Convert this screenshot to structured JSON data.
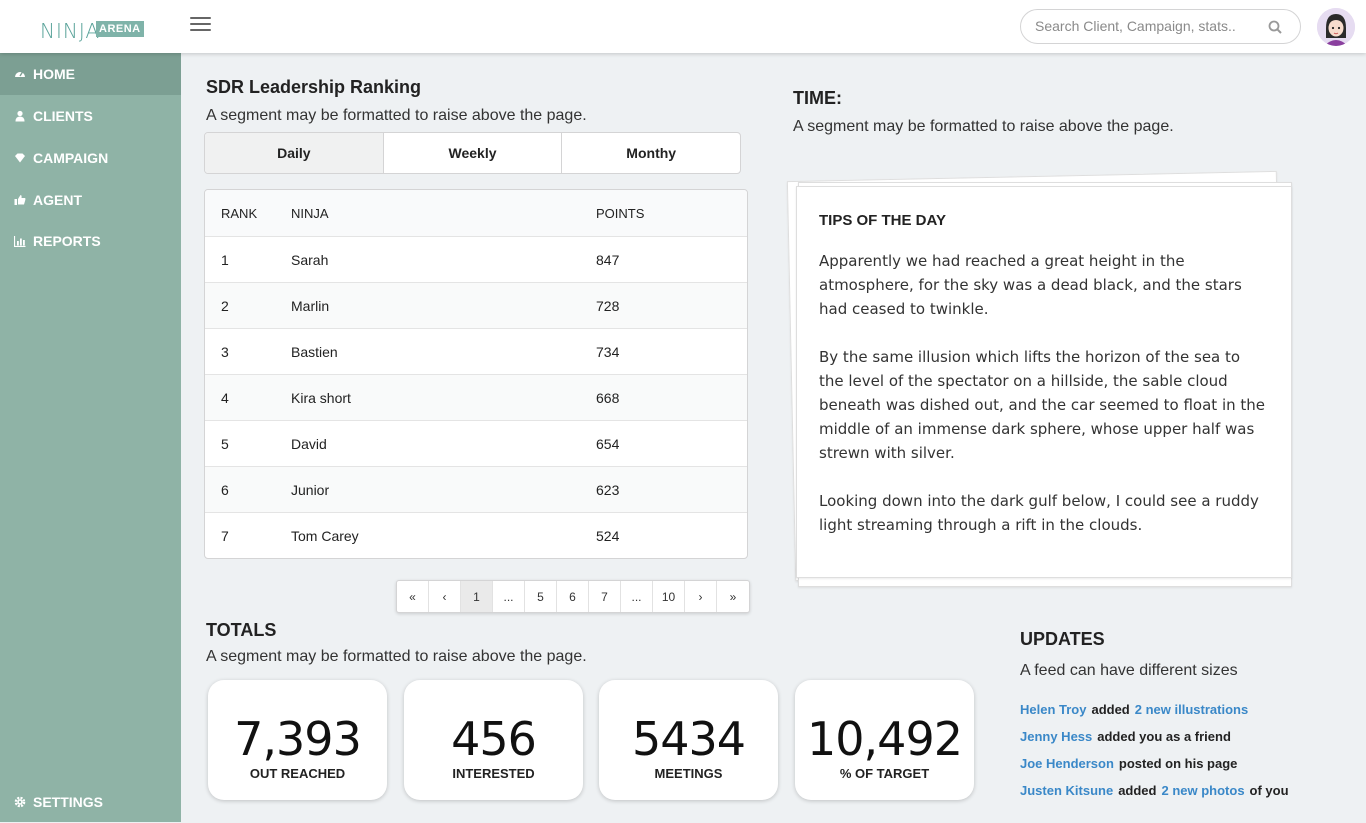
{
  "logo": {
    "ninja": "NINJA",
    "arena": "ARENA"
  },
  "search": {
    "placeholder": "Search Client, Campaign, stats.."
  },
  "sidebar": {
    "items": [
      {
        "label": "HOME",
        "icon": "dashboard-icon"
      },
      {
        "label": "CLIENTS",
        "icon": "user-icon"
      },
      {
        "label": "CAMPAIGN",
        "icon": "diamond-icon"
      },
      {
        "label": "AGENT",
        "icon": "thumbs-up-icon"
      },
      {
        "label": "REPORTS",
        "icon": "bar-chart-icon"
      }
    ],
    "settings": "SETTINGS"
  },
  "sdr": {
    "title": "SDR Leadership Ranking",
    "subtitle": "A segment may be formatted to raise above the page.",
    "tabs": [
      "Daily",
      "Weekly",
      "Monthy"
    ],
    "columns": [
      "RANK",
      "NINJA",
      "POINTS"
    ],
    "rows": [
      {
        "rank": "1",
        "name": "Sarah",
        "points": "847"
      },
      {
        "rank": "2",
        "name": "Marlin",
        "points": "728"
      },
      {
        "rank": "3",
        "name": "Bastien",
        "points": "734"
      },
      {
        "rank": "4",
        "name": "Kira short",
        "points": "668"
      },
      {
        "rank": "5",
        "name": "David",
        "points": "654"
      },
      {
        "rank": "6",
        "name": "Junior",
        "points": "623"
      },
      {
        "rank": "7",
        "name": "Tom Carey",
        "points": "524"
      }
    ],
    "pager": [
      "«",
      "‹",
      "1",
      "...",
      "5",
      "6",
      "7",
      "...",
      "10",
      "›",
      "»"
    ]
  },
  "time": {
    "title": "TIME:",
    "subtitle": "A segment may be formatted to raise above the page."
  },
  "tips": {
    "title": "TIPS OF THE DAY",
    "paragraphs": [
      "Apparently we had reached a great height in the atmosphere, for the sky was a dead black, and the stars had ceased to twinkle.",
      "By the same illusion which lifts the horizon of the sea to the level of the spectator on a hillside, the sable cloud beneath was dished out, and the car seemed to float in the middle of an immense dark sphere, whose upper half was strewn with silver.",
      "Looking down into the dark gulf below, I could see a ruddy light streaming through a rift in the clouds."
    ]
  },
  "totals": {
    "title": "TOTALS",
    "subtitle": "A segment may be formatted to raise above the page.",
    "stats": [
      {
        "value": "7,393",
        "label": "OUT REACHED"
      },
      {
        "value": "456",
        "label": "INTERESTED"
      },
      {
        "value": "5434",
        "label": "MEETINGS"
      },
      {
        "value": "10,492",
        "label": "% OF TARGET"
      }
    ]
  },
  "updates": {
    "title": "UPDATES",
    "subtitle": "A feed can have different sizes",
    "feed": [
      {
        "user": "Helen Troy",
        "action": "added",
        "link": "2 new illustrations",
        "tail": ""
      },
      {
        "user": "Jenny Hess",
        "action": "added you as a friend",
        "link": "",
        "tail": ""
      },
      {
        "user": "Joe Henderson",
        "action": "posted on his page",
        "link": "",
        "tail": ""
      },
      {
        "user": "Justen Kitsune",
        "action": "added",
        "link": "2 new photos",
        "tail": "of you"
      }
    ]
  },
  "colors": {
    "sidebar": "#8fb3a6",
    "sidebar_active": "#7c9f93",
    "link": "#3a88c8",
    "background": "#eef1f3"
  }
}
